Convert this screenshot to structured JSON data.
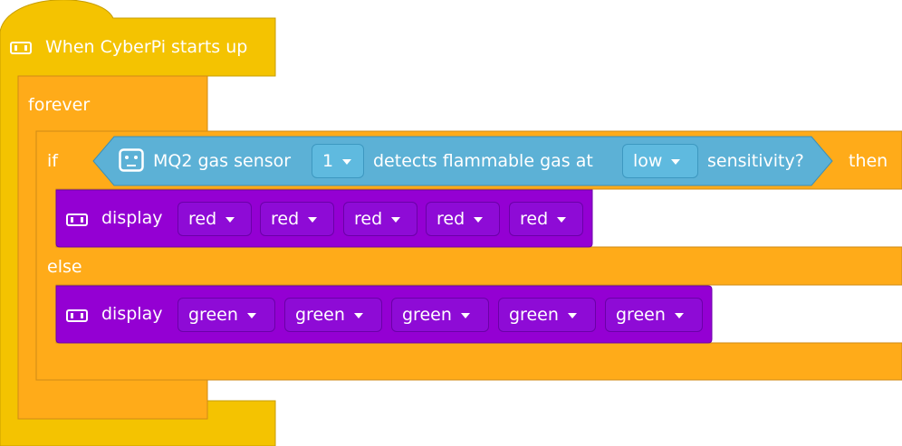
{
  "hat": {
    "label": "When CyberPi starts up"
  },
  "forever": {
    "label": "forever"
  },
  "if_block": {
    "if_label": "if",
    "then_label": "then",
    "else_label": "else"
  },
  "condition": {
    "prefix": "MQ2 gas sensor",
    "port_value": "1",
    "middle": "detects flammable gas at",
    "sensitivity_value": "low",
    "suffix": "sensitivity?"
  },
  "display_red": {
    "label": "display",
    "colors": [
      "red",
      "red",
      "red",
      "red",
      "red"
    ]
  },
  "display_green": {
    "label": "display",
    "colors": [
      "green",
      "green",
      "green",
      "green",
      "green"
    ]
  },
  "colors": {
    "hat": "#f4c301",
    "control": "#ffab19",
    "sensor": "#5cb1d6",
    "display": "#9400d3",
    "dropdown_purple": "#8e0bd6",
    "dropdown_blue": "#5fbadf"
  },
  "icons": [
    "cyberpi-led-icon",
    "cyberpi-board-icon",
    "dropdown-arrow-icon"
  ]
}
